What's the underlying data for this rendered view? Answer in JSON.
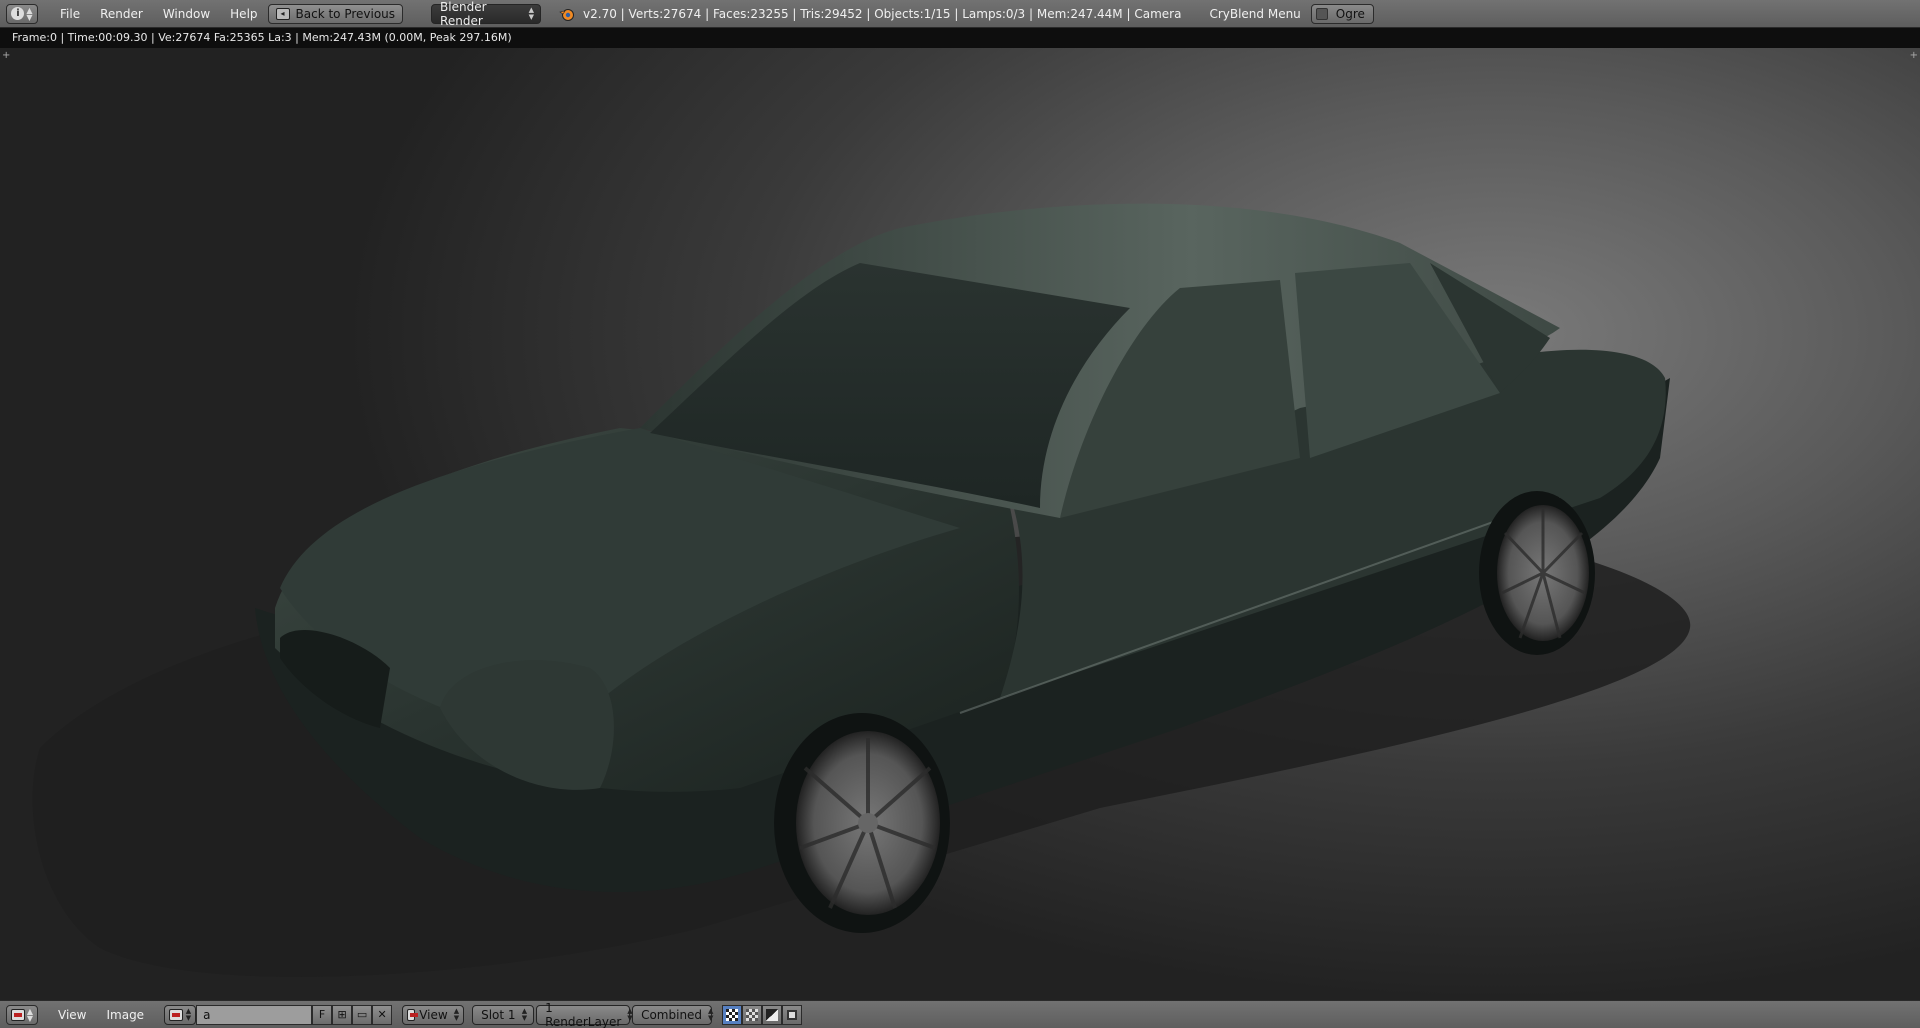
{
  "top_header": {
    "editor_type_icon": "info-icon",
    "menus": [
      "File",
      "Render",
      "Window",
      "Help"
    ],
    "back_button": "Back to Previous",
    "render_engine": "Blender Render",
    "stats": "v2.70 | Verts:27674 | Faces:23255 | Tris:29452 | Objects:1/15 | Lamps:0/3 | Mem:247.44M | Camera",
    "addon_menu": "CryBlend Menu",
    "ogre_label": "Ogre"
  },
  "render_info": "Frame:0 | Time:00:09.30 | Ve:27674 Fa:25365 La:3 | Mem:247.43M (0.00M, Peak 297.16M)",
  "bottom_header": {
    "editor_type_icon": "image-editor-icon",
    "menus": [
      "View",
      "Image"
    ],
    "image_name": "a",
    "fake_user_label": "F",
    "view_dropdown": "View",
    "slot_dropdown": "Slot 1",
    "layer_dropdown": "1 RenderLayer",
    "pass_dropdown": "Combined"
  },
  "colors": {
    "header_bg": "#666666",
    "info_bg": "#0e0e0e",
    "car_body": "#2b3531",
    "active_button": "#5680c2"
  }
}
